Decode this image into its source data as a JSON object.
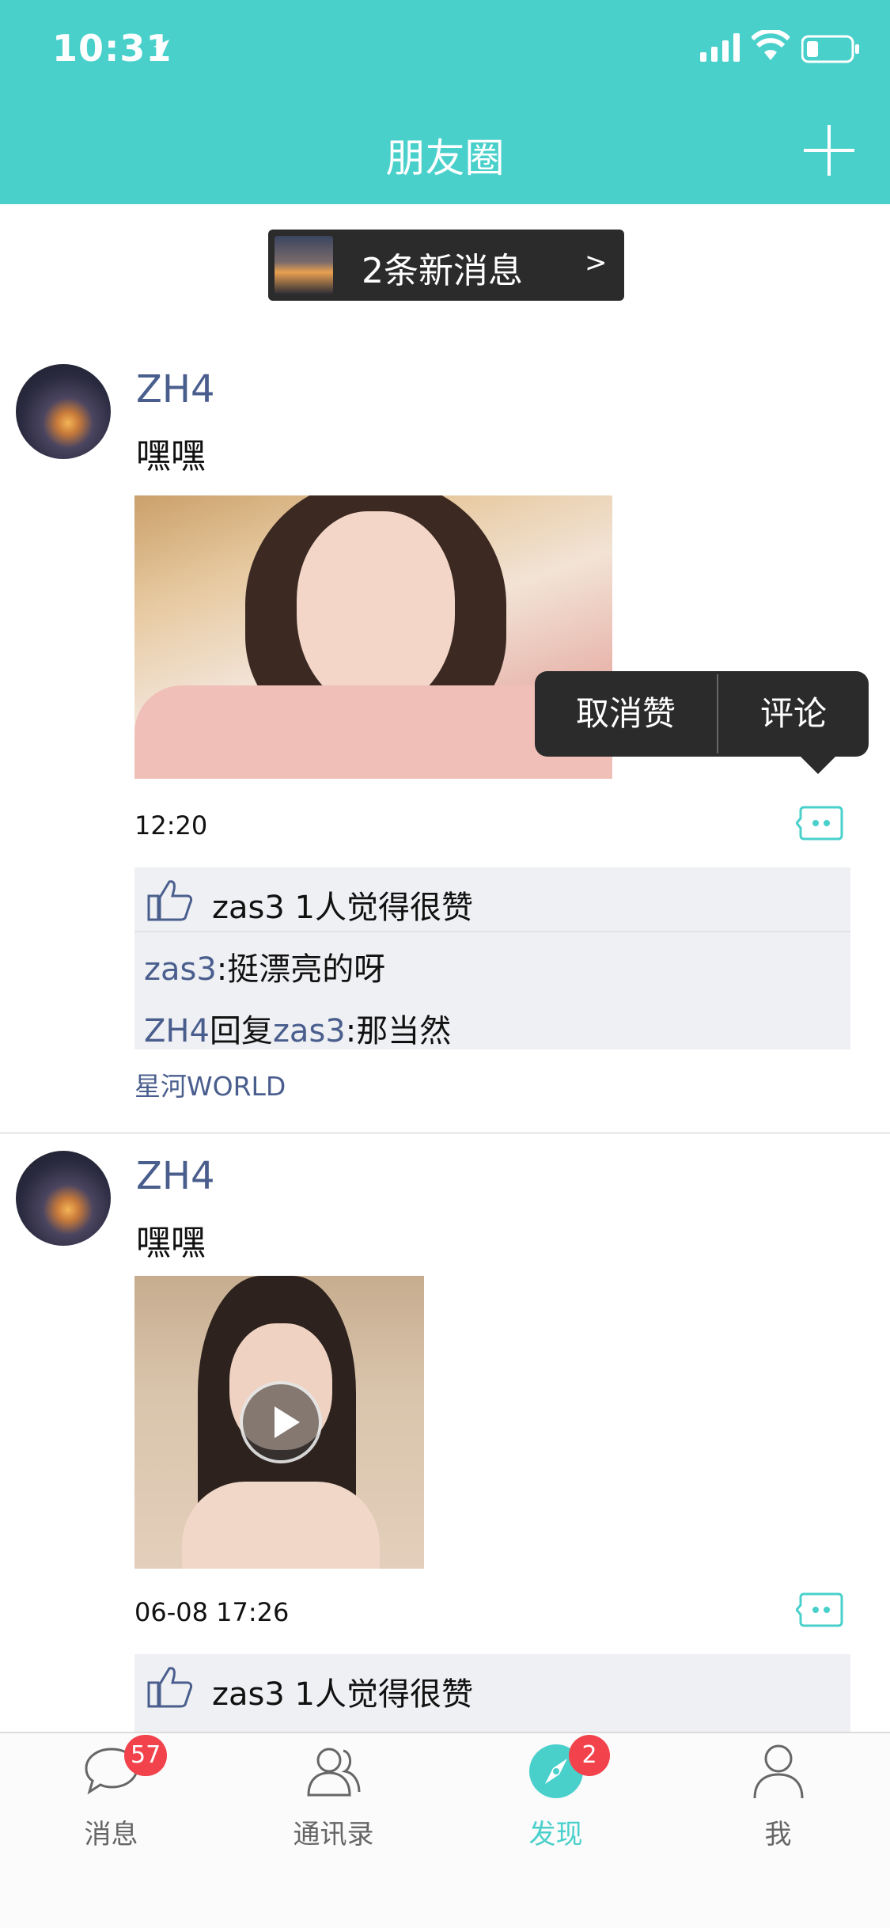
{
  "status_bar": {
    "time": "10:31"
  },
  "nav": {
    "title": "朋友圈"
  },
  "new_message_banner": {
    "text": "2条新消息",
    "arrow": ">"
  },
  "posts": [
    {
      "author": "ZH4",
      "text": "嘿嘿",
      "time": "12:20",
      "likes": "zas3 1人觉得很赞",
      "comments": [
        {
          "from": "zas3",
          "reply_label": "",
          "to": "",
          "text": ":挺漂亮的呀"
        },
        {
          "from": "ZH4",
          "reply_label": "回复",
          "to": "zas3",
          "text": ":那当然"
        }
      ],
      "source": "星河WORLD"
    },
    {
      "author": "ZH4",
      "text": "嘿嘿",
      "time": "06-08 17:26",
      "likes": "zas3 1人觉得很赞"
    }
  ],
  "popup_menu": {
    "unlike": "取消赞",
    "comment": "评论"
  },
  "tabbar": {
    "tabs": [
      {
        "label": "消息",
        "badge": "57",
        "icon": "chat-bubble-icon"
      },
      {
        "label": "通讯录",
        "badge": "",
        "icon": "contacts-icon"
      },
      {
        "label": "发现",
        "badge": "2",
        "icon": "compass-icon",
        "active": true
      },
      {
        "label": "我",
        "badge": "",
        "icon": "person-icon"
      }
    ]
  },
  "colors": {
    "brand": "#49d0cb",
    "name_link": "#4a5e8e",
    "badge": "#f2424b"
  }
}
